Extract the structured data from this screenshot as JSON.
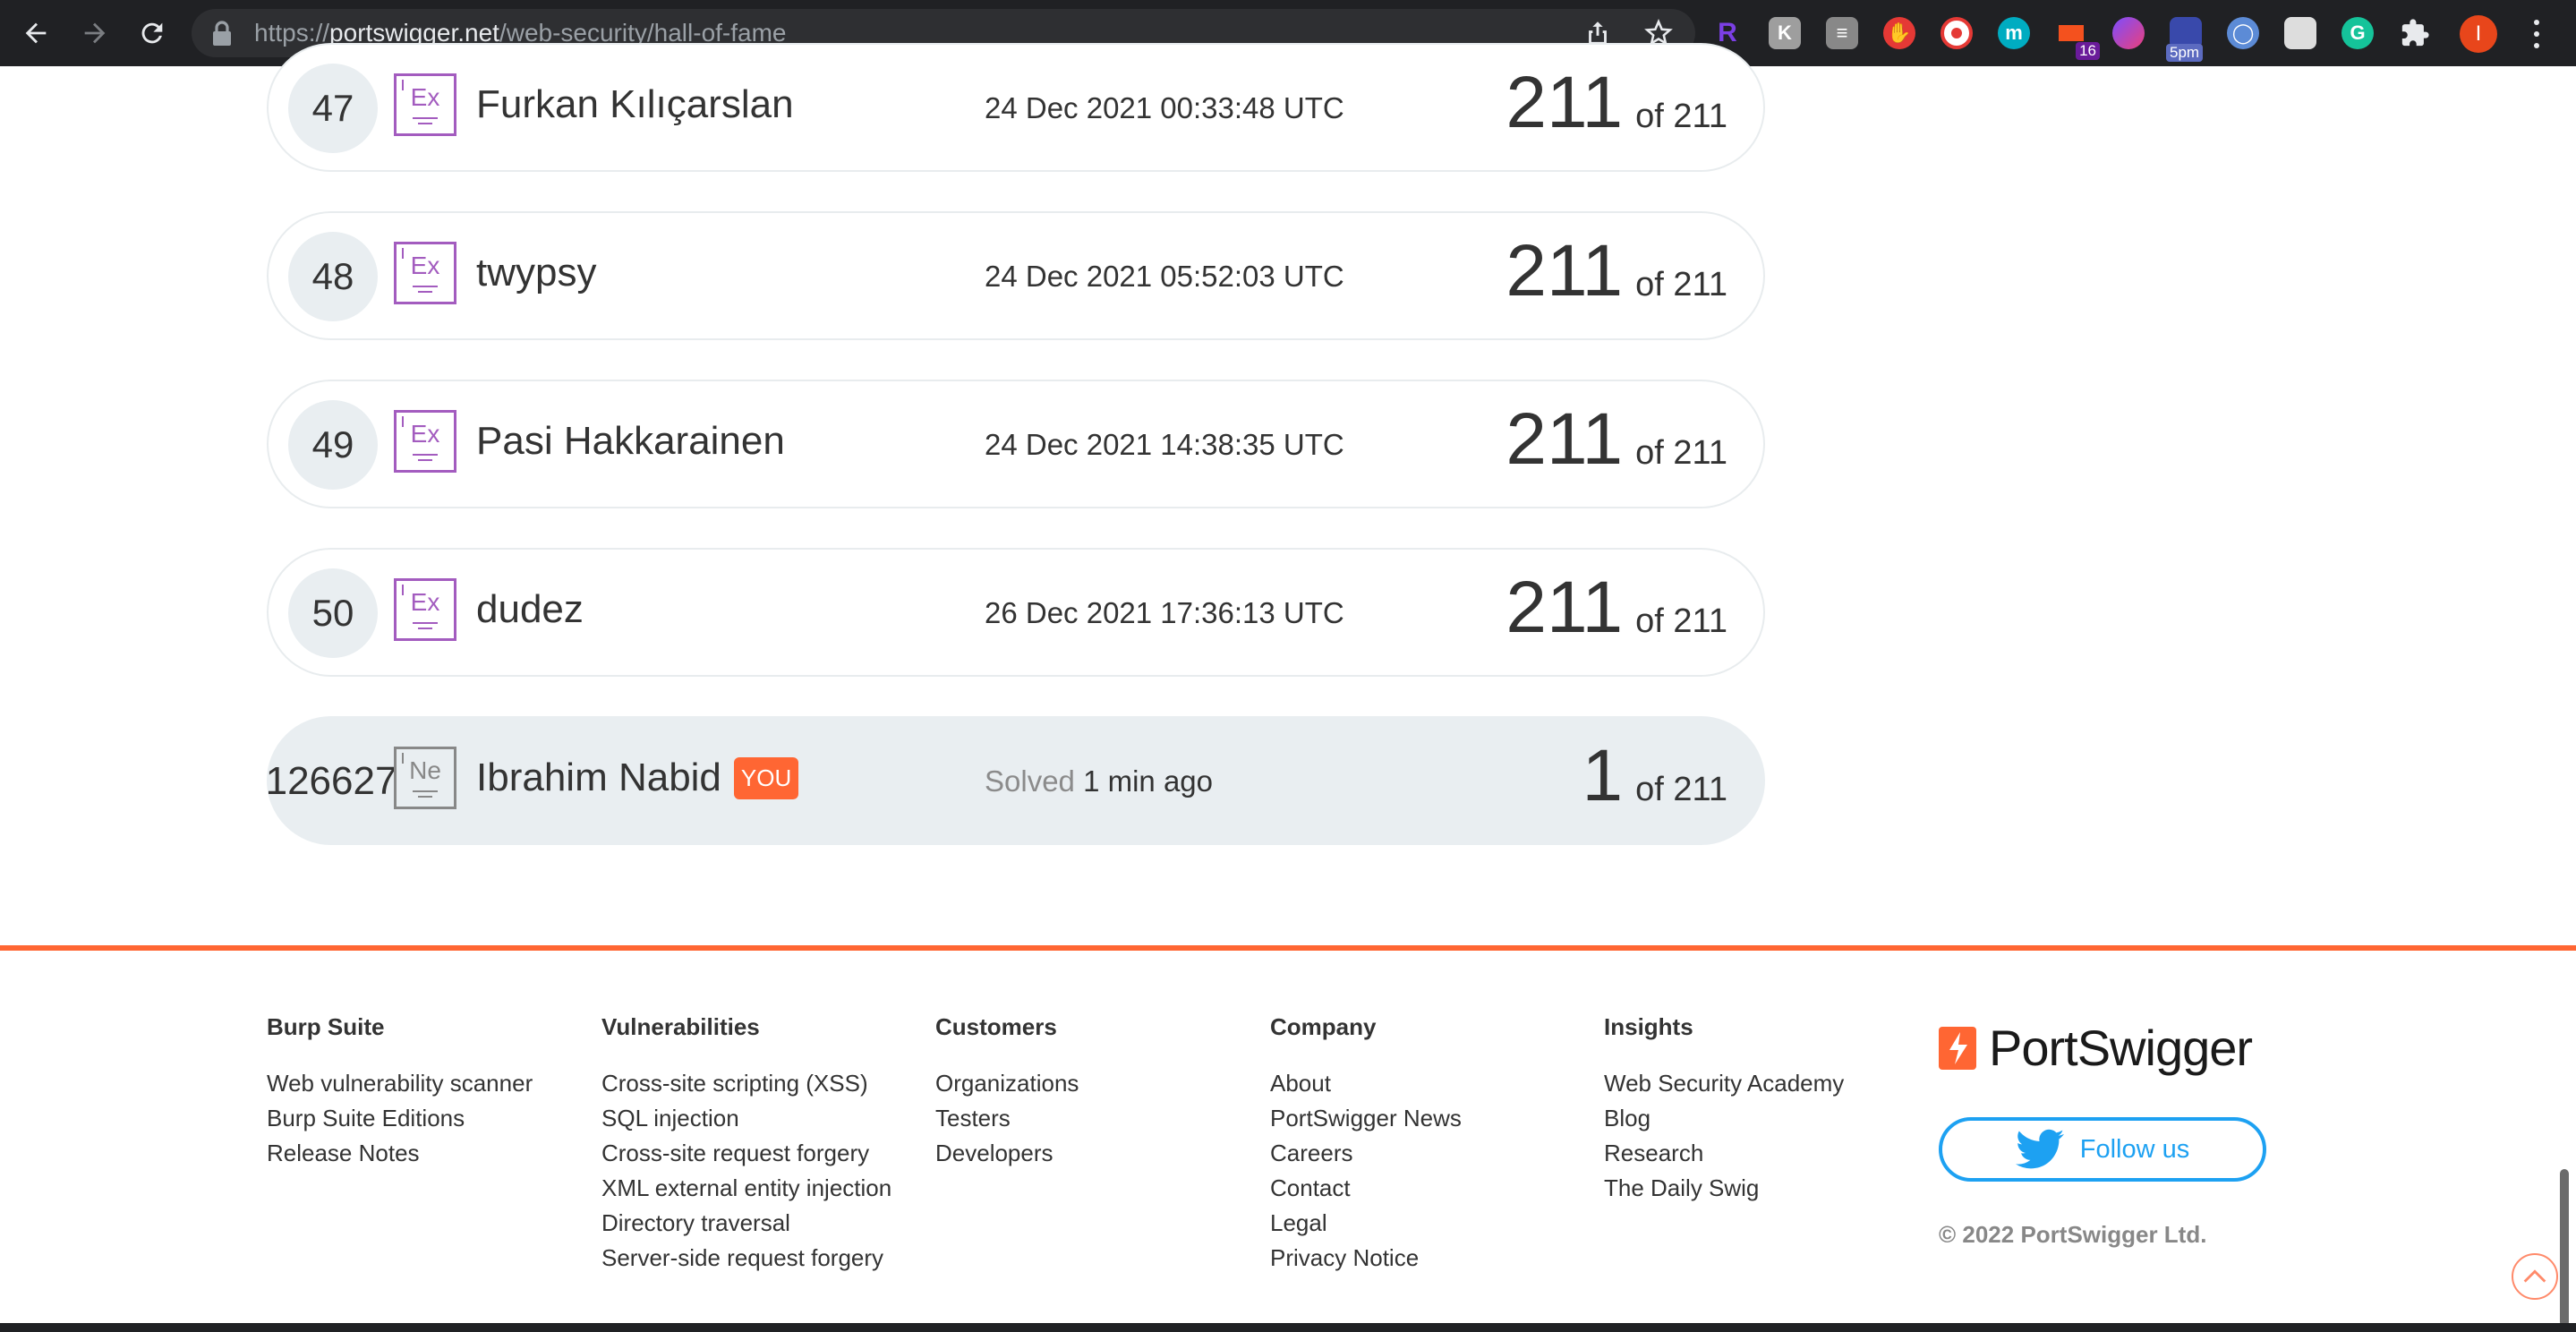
{
  "browser": {
    "url_scheme": "https://",
    "url_host": "portswigger.net",
    "url_path": "/web-security/hall-of-fame",
    "extensions": [
      {
        "icon": "R",
        "color": "#7b3fe4"
      },
      {
        "icon": "K",
        "color": "#9e9e9e"
      },
      {
        "icon": "notes",
        "color": "#888888"
      },
      {
        "icon": "stop",
        "color": "#e53935"
      },
      {
        "icon": "record",
        "color": "#e53935"
      },
      {
        "icon": "m",
        "color": "#00acc1"
      },
      {
        "icon": "flag",
        "color": "#f4511e",
        "badge": "16"
      },
      {
        "icon": "circle",
        "color": "#ab47bc"
      },
      {
        "icon": "clock",
        "color": "#5c6bc0",
        "badge": "5pm"
      },
      {
        "icon": "drop",
        "color": "#5c8bd6"
      },
      {
        "icon": "page",
        "color": "#dddddd"
      },
      {
        "icon": "G",
        "color": "#15c39a"
      },
      {
        "icon": "puzzle",
        "color": "#e8eaed"
      }
    ],
    "profile_initial": "I"
  },
  "leaderboard": {
    "rows": [
      {
        "rank": "47",
        "badge": "Ex",
        "name": "Furkan Kılıçarslan",
        "time": "24 Dec 2021 00:33:48 UTC",
        "solved": "211",
        "total": "of 211"
      },
      {
        "rank": "48",
        "badge": "Ex",
        "name": "twypsy",
        "time": "24 Dec 2021 05:52:03 UTC",
        "solved": "211",
        "total": "of 211"
      },
      {
        "rank": "49",
        "badge": "Ex",
        "name": "Pasi Hakkarainen",
        "time": "24 Dec 2021 14:38:35 UTC",
        "solved": "211",
        "total": "of 211"
      },
      {
        "rank": "50",
        "badge": "Ex",
        "name": "dudez",
        "time": "26 Dec 2021 17:36:13 UTC",
        "solved": "211",
        "total": "of 211"
      }
    ],
    "you": {
      "rank": "126627",
      "badge": "Ne",
      "name": "Ibrahim Nabid",
      "tag": "YOU",
      "time_label": "Solved",
      "time": "1 min ago",
      "solved": "1",
      "total": "of 211"
    }
  },
  "footer": {
    "columns": [
      {
        "title": "Burp Suite",
        "links": [
          "Web vulnerability scanner",
          "Burp Suite Editions",
          "Release Notes"
        ]
      },
      {
        "title": "Vulnerabilities",
        "links": [
          "Cross-site scripting (XSS)",
          "SQL injection",
          "Cross-site request forgery",
          "XML external entity injection",
          "Directory traversal",
          "Server-side request forgery"
        ]
      },
      {
        "title": "Customers",
        "links": [
          "Organizations",
          "Testers",
          "Developers"
        ]
      },
      {
        "title": "Company",
        "links": [
          "About",
          "PortSwigger News",
          "Careers",
          "Contact",
          "Legal",
          "Privacy Notice"
        ]
      },
      {
        "title": "Insights",
        "links": [
          "Web Security Academy",
          "Blog",
          "Research",
          "The Daily Swig"
        ]
      }
    ],
    "brand": "PortSwigger",
    "follow_label": "Follow us",
    "copyright": "© 2022 PortSwigger Ltd.",
    "accent": "#ff6633",
    "twitter_color": "#1da1f2"
  }
}
